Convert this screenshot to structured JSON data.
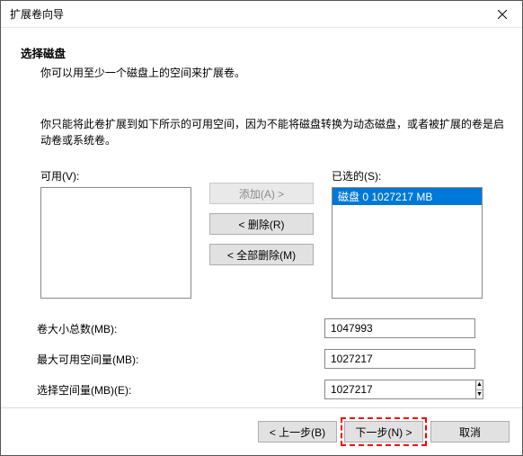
{
  "window": {
    "title": "扩展卷向导"
  },
  "header": {
    "heading": "选择磁盘",
    "subheading": "你可以用至少一个磁盘上的空间来扩展卷。"
  },
  "description": "你只能将此卷扩展到如下所示的可用空间，因为不能将磁盘转换为动态磁盘，或者被扩展的卷是启动卷或系统卷。",
  "lists": {
    "available_label": "可用(V):",
    "selected_label": "已选的(S):",
    "selected_items": [
      {
        "text": "磁盘 0     1027217 MB",
        "selected": true
      }
    ]
  },
  "buttons": {
    "add": "添加(A) >",
    "remove": "< 删除(R)",
    "remove_all": "< 全部删除(M)",
    "back": "< 上一步(B)",
    "next": "下一步(N) >",
    "cancel": "取消"
  },
  "fields": {
    "total_label": "卷大小总数(MB):",
    "total_value": "1047993",
    "max_label": "最大可用空间量(MB):",
    "max_value": "1027217",
    "select_label": "选择空间量(MB)(E):",
    "select_value": "1027217"
  }
}
